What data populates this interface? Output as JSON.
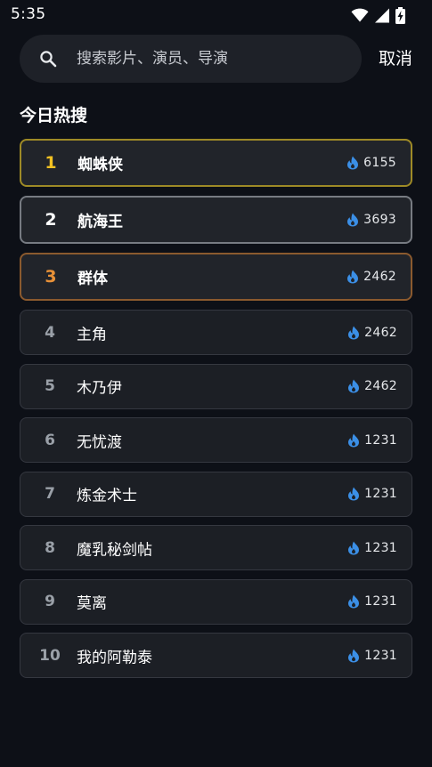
{
  "status_bar": {
    "time": "5:35",
    "icons": [
      "wifi-icon",
      "cellular-signal-icon",
      "battery-charging-icon"
    ]
  },
  "search": {
    "placeholder": "搜索影片、演员、导演",
    "cancel_label": "取消",
    "icon": "search-icon"
  },
  "section": {
    "title": "今日热搜"
  },
  "colors": {
    "background": "#0d1017",
    "card": "#1c1f25",
    "rank1": "#f2c122",
    "rank2": "#ffffff",
    "rank3": "#e89138",
    "rank1_border": "#9e8a26",
    "rank2_border": "#777b82",
    "rank3_border": "#8b5a2e",
    "flame": "#3b8fe6"
  },
  "ranking": [
    {
      "rank": "1",
      "title": "蜘蛛侠",
      "heat": "6155"
    },
    {
      "rank": "2",
      "title": "航海王",
      "heat": "3693"
    },
    {
      "rank": "3",
      "title": "群体",
      "heat": "2462"
    },
    {
      "rank": "4",
      "title": "主角",
      "heat": "2462"
    },
    {
      "rank": "5",
      "title": "木乃伊",
      "heat": "2462"
    },
    {
      "rank": "6",
      "title": "无忧渡",
      "heat": "1231"
    },
    {
      "rank": "7",
      "title": "炼金术士",
      "heat": "1231"
    },
    {
      "rank": "8",
      "title": "魔乳秘剑帖",
      "heat": "1231"
    },
    {
      "rank": "9",
      "title": "莫离",
      "heat": "1231"
    },
    {
      "rank": "10",
      "title": "我的阿勒泰",
      "heat": "1231"
    }
  ]
}
